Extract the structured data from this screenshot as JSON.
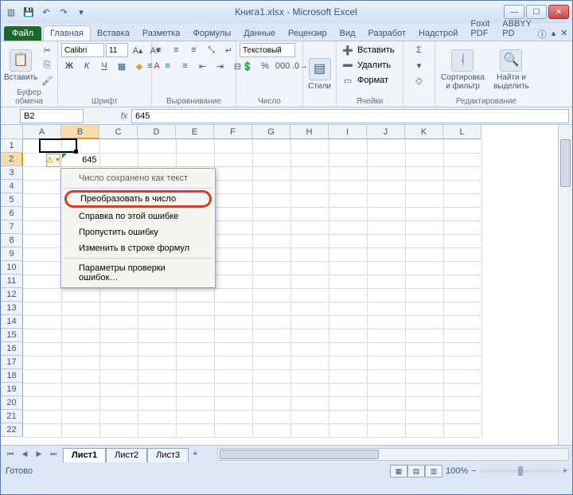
{
  "title": "Книга1.xlsx - Microsoft Excel",
  "tabs": {
    "file": "Файл",
    "items": [
      "Главная",
      "Вставка",
      "Разметка",
      "Формулы",
      "Данные",
      "Рецензир",
      "Вид",
      "Разработ",
      "Надстрой",
      "Foxit PDF",
      "ABBYY PD"
    ],
    "active": 0
  },
  "ribbon": {
    "paste": "Вставить",
    "clipboard": "Буфер обмена",
    "font_name": "Calibri",
    "font_size": "11",
    "font": "Шрифт",
    "alignment": "Выравнивание",
    "number_format": "Текстовый",
    "number": "Число",
    "styles": "Стили",
    "insert": "Вставить",
    "delete": "Удалить",
    "format": "Формат",
    "cells": "Ячейки",
    "sort": "Сортировка и фильтр",
    "find": "Найти и выделить",
    "editing": "Редактирование"
  },
  "formula": {
    "name_box": "B2",
    "fx": "fx",
    "value": "645"
  },
  "grid": {
    "columns": [
      "A",
      "B",
      "C",
      "D",
      "E",
      "F",
      "G",
      "H",
      "I",
      "J",
      "K",
      "L"
    ],
    "rows_count": 22,
    "active_col": "B",
    "active_row": 2,
    "cell_b2": "645"
  },
  "menu": {
    "header": "Число сохранено как текст",
    "items": [
      "Преобразовать в число",
      "Справка по этой ошибке",
      "Пропустить ошибку",
      "Изменить в строке формул",
      "Параметры проверки ошибок…"
    ],
    "highlight": 0
  },
  "sheets": {
    "items": [
      "Лист1",
      "Лист2",
      "Лист3"
    ],
    "active": 0
  },
  "status": {
    "ready": "Готово",
    "zoom": "100%"
  }
}
